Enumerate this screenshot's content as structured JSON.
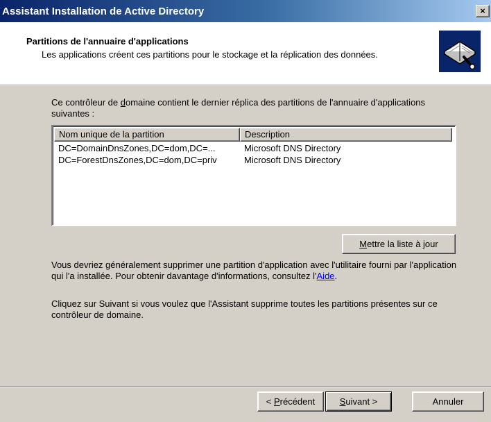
{
  "window": {
    "title": "Assistant Installation de Active Directory",
    "close_label": "×"
  },
  "header": {
    "title": "Partitions de l'annuaire d'applications",
    "subtitle": "Les applications créent ces partitions pour le stockage et la réplication des données.",
    "icon": "book-tool-icon"
  },
  "intro": {
    "before": "Ce contrôleur de ",
    "underlined": "d",
    "after": "omaine contient le dernier réplica des partitions de l'annuaire d'applications suivantes :"
  },
  "partitions": {
    "columns": [
      "Nom unique de la partition",
      "Description"
    ],
    "rows": [
      [
        "DC=DomainDnsZones,DC=dom,DC=...",
        "Microsoft DNS Directory"
      ],
      [
        "DC=ForestDnsZones,DC=dom,DC=priv",
        "Microsoft DNS Directory"
      ]
    ]
  },
  "refresh_button": {
    "underlined": "M",
    "rest": "ettre la liste à jour"
  },
  "note": {
    "text": "Vous devriez généralement supprimer une partition d'application avec l'utilitaire fourni par l'application qui l'a installée. Pour obtenir davantage d'informations, consultez l'",
    "link": "Aide",
    "end": "."
  },
  "instruction": "Cliquez sur Suivant si vous voulez que l'Assistant supprime toutes les partitions présentes sur ce contrôleur de domaine.",
  "footer": {
    "back": {
      "prefix": "< ",
      "underlined": "P",
      "rest": "récédent"
    },
    "next": {
      "underlined": "S",
      "rest": "uivant >"
    },
    "cancel": "Annuler"
  }
}
